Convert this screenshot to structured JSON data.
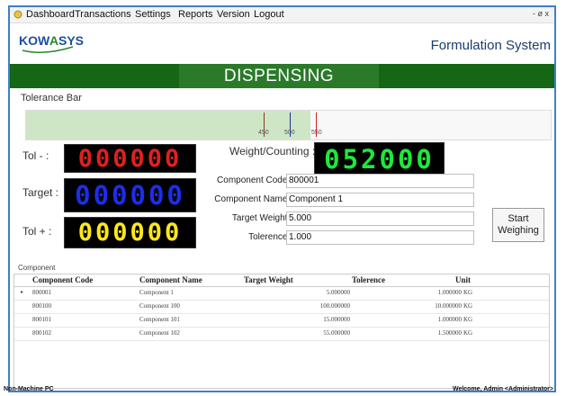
{
  "menu": {
    "items": [
      "Dashboard",
      "Transactions",
      "Settings",
      "Reports",
      "Version",
      "Logout"
    ],
    "window_controls": "- ø x"
  },
  "header": {
    "logo_text": "KOWASYS",
    "system_title": "Formulation System"
  },
  "banner": {
    "title": "DISPENSING"
  },
  "tolerance_bar": {
    "label": "Tolerance Bar",
    "markers": [
      "450",
      "500",
      "550"
    ],
    "colors": {
      "fill": "#cfe6c6",
      "low": "#8b3a1a",
      "target": "#1a2e9c",
      "high": "#d02020"
    }
  },
  "readouts": {
    "tol_minus_label": "Tol - :",
    "tol_minus_value": "000000",
    "target_label": "Target :",
    "target_value": "000000",
    "tol_plus_label": "Tol + :",
    "tol_plus_value": "000000",
    "weight_label": "Weight/Counting :",
    "weight_value": "052000"
  },
  "form": {
    "component_code_label": "Component Code :",
    "component_code_value": "800001",
    "component_name_label": "Component Name :",
    "component_name_value": "Component 1",
    "target_weight_label": "Target Weight :",
    "target_weight_value": "5.000",
    "tolerence_label": "Tolerence :",
    "tolerence_value": "1.000",
    "start_button_line1": "Start",
    "start_button_line2": "Weighing"
  },
  "grid": {
    "group_label": "Component",
    "columns": [
      "Component Code",
      "Component Name",
      "Target Weight",
      "Tolerence",
      "Unit"
    ],
    "rows": [
      {
        "code": "800001",
        "name": "Component 1",
        "target": "5.000000",
        "tol": "1.000000",
        "unit": "KG"
      },
      {
        "code": "800100",
        "name": "Component 100",
        "target": "100.000000",
        "tol": "10.000000",
        "unit": "KG"
      },
      {
        "code": "800101",
        "name": "Component 101",
        "target": "15.000000",
        "tol": "1.000000",
        "unit": "KG"
      },
      {
        "code": "800102",
        "name": "Component 102",
        "target": "55.000000",
        "tol": "1.500000",
        "unit": "KG"
      }
    ]
  },
  "status": {
    "left": "Non-Machine PC",
    "right": "Welcome, Admin <Administrator>"
  }
}
